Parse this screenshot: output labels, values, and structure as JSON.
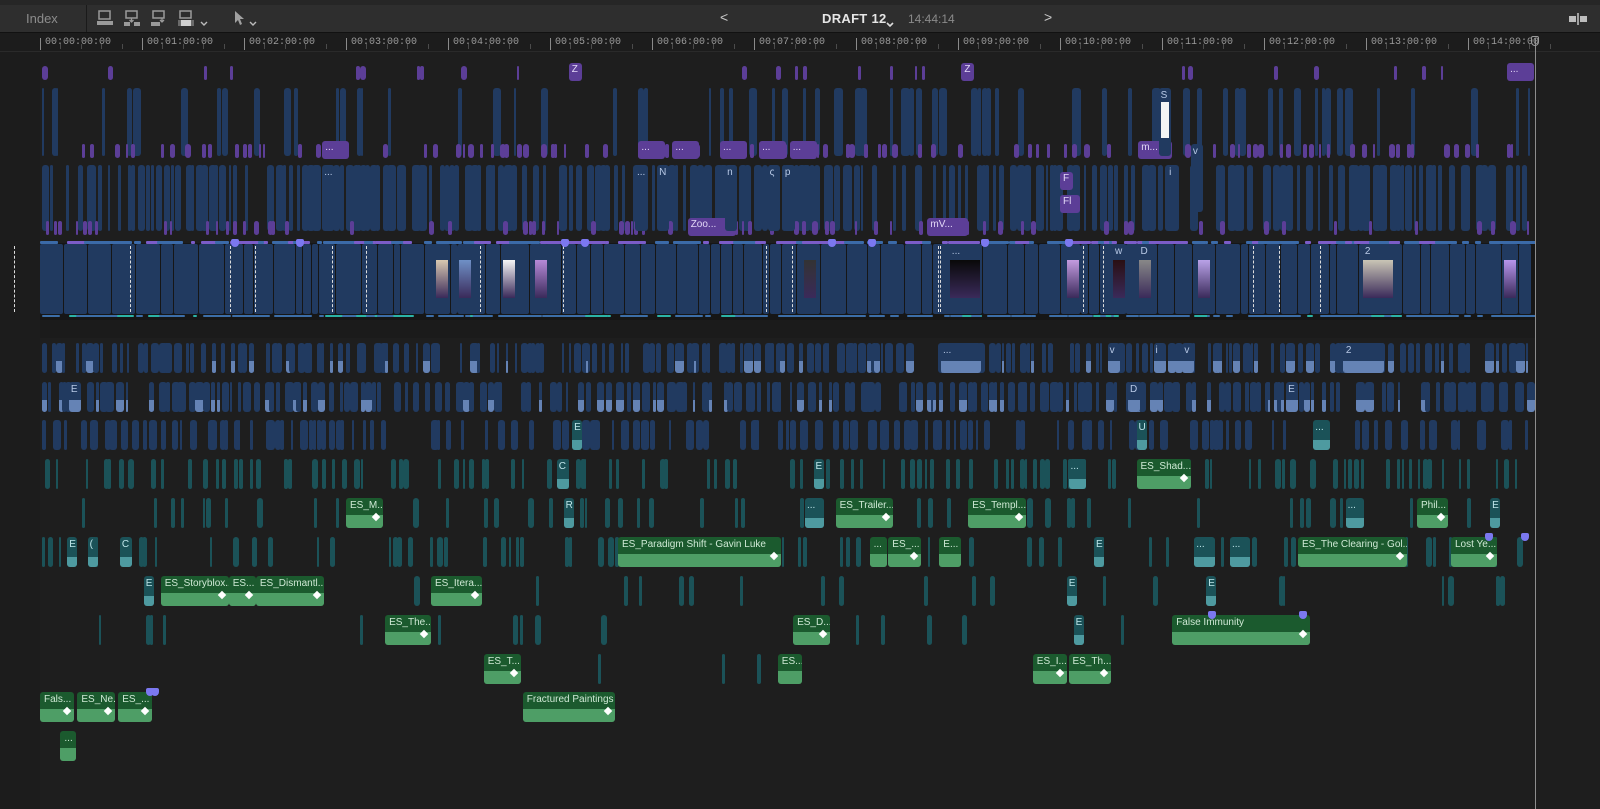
{
  "toolbar": {
    "index_label": "Index",
    "project_name": "DRAFT 12",
    "project_duration": "14:44:14",
    "prev_label": "<",
    "next_label": ">",
    "edit_buttons": [
      "connect-clip",
      "insert-clip",
      "append-clip",
      "overwrite-clip"
    ],
    "tool": "select-arrow"
  },
  "ruler": {
    "labels": [
      "00:00:00:00",
      "00:01:00:00",
      "00:02:00:00",
      "00:03:00:00",
      "00:04:00:00",
      "00:05:00:00",
      "00:06:00:00",
      "00:07:00:00",
      "00:08:00:00",
      "00:09:00:00",
      "00:10:00:00",
      "00:11:00:00",
      "00:12:00:00",
      "00:13:00:00",
      "00:14:00:00"
    ]
  },
  "playhead": {
    "timecode_seconds": 870
  },
  "colors": {
    "video": "#213a60",
    "title": "#5c3e97",
    "audio": "#1b5a2e",
    "audio_teal": "#1b5258",
    "marker": "#7b78f0"
  },
  "timeline": {
    "titles": [
      {
        "t": 311,
        "lane": "t1",
        "label": "Z"
      },
      {
        "t": 542,
        "lane": "t1",
        "label": "Z"
      },
      {
        "t": 863,
        "lane": "t1",
        "label": "..."
      },
      {
        "t": 166,
        "lane": "t3",
        "label": "..."
      },
      {
        "t": 352,
        "lane": "t3",
        "label": "..."
      },
      {
        "t": 372,
        "lane": "t3",
        "label": "..."
      },
      {
        "t": 400,
        "lane": "t3",
        "label": "..."
      },
      {
        "t": 423,
        "lane": "t3",
        "label": "..."
      },
      {
        "t": 441,
        "lane": "t3",
        "label": "..."
      },
      {
        "t": 646,
        "lane": "t3",
        "label": "m..."
      },
      {
        "t": 381,
        "lane": "t4b",
        "label": "Zoo..."
      },
      {
        "t": 522,
        "lane": "t4b",
        "label": "mV..."
      },
      {
        "t": 600,
        "lane": "t4a",
        "label": "F"
      },
      {
        "t": 600,
        "lane": "t4c",
        "label": "Fl"
      }
    ],
    "connected_video": [
      {
        "t": 166,
        "lane": "v1",
        "label": "..."
      },
      {
        "t": 350,
        "lane": "v1",
        "label": "..."
      },
      {
        "t": 363,
        "lane": "v1",
        "label": "N"
      },
      {
        "t": 403,
        "lane": "v1",
        "label": "n"
      },
      {
        "t": 428,
        "lane": "v1",
        "label": "ς"
      },
      {
        "t": 437,
        "lane": "v1",
        "label": "p"
      },
      {
        "t": 658,
        "lane": "v0",
        "label": "S"
      },
      {
        "t": 663,
        "lane": "v1",
        "label": "i"
      },
      {
        "t": 677,
        "lane": "v1b",
        "label": "v"
      },
      {
        "t": 530,
        "lane": "a1",
        "label": "..."
      },
      {
        "t": 767,
        "lane": "a1",
        "label": "2"
      },
      {
        "t": 628,
        "lane": "a1",
        "label": "v"
      },
      {
        "t": 655,
        "lane": "a1",
        "label": "i"
      },
      {
        "t": 672,
        "lane": "a1",
        "label": "v"
      },
      {
        "t": 17,
        "lane": "a2",
        "label": "E"
      },
      {
        "t": 640,
        "lane": "a2",
        "label": "D"
      },
      {
        "t": 733,
        "lane": "a2",
        "label": "E"
      }
    ],
    "primary_storyline": {
      "thumbnail_clips": [
        {
          "t": 232,
          "label": ""
        },
        {
          "t": 245,
          "label": ""
        },
        {
          "t": 271,
          "label": ""
        },
        {
          "t": 290,
          "label": ""
        },
        {
          "t": 448,
          "label": ""
        },
        {
          "t": 534,
          "label": "..."
        },
        {
          "t": 603,
          "label": ""
        },
        {
          "t": 630,
          "label": "w"
        },
        {
          "t": 645,
          "label": "D"
        },
        {
          "t": 680,
          "label": ""
        },
        {
          "t": 777,
          "label": "2"
        },
        {
          "t": 860,
          "label": ""
        }
      ]
    },
    "audio_named": [
      {
        "t": 180,
        "dur": 22,
        "lane": "a5",
        "label": "ES_M..."
      },
      {
        "t": 468,
        "dur": 34,
        "lane": "a5",
        "label": "ES_Trailer..."
      },
      {
        "t": 546,
        "dur": 34,
        "lane": "a5",
        "label": "ES_Templ..."
      },
      {
        "t": 645,
        "dur": 32,
        "lane": "a4",
        "label": "ES_Shad..."
      },
      {
        "t": 810,
        "dur": 18,
        "lane": "a5",
        "label": "Phil..."
      },
      {
        "t": 340,
        "dur": 96,
        "lane": "a6",
        "label": "ES_Paradigm Shift - Gavin Luke"
      },
      {
        "t": 488,
        "dur": 10,
        "lane": "a6",
        "label": "..."
      },
      {
        "t": 499,
        "dur": 19,
        "lane": "a6",
        "label": "ES_..."
      },
      {
        "t": 529,
        "dur": 13,
        "lane": "a6",
        "label": "E..."
      },
      {
        "t": 740,
        "dur": 64,
        "lane": "a6",
        "label": "ES_The Clearing - Gol..."
      },
      {
        "t": 830,
        "dur": 27,
        "lane": "a6",
        "label": "Lost Ye..."
      },
      {
        "t": 71,
        "dur": 40,
        "lane": "a7",
        "label": "ES_Storyblox..."
      },
      {
        "t": 111,
        "dur": 16,
        "lane": "a7",
        "label": "ES..."
      },
      {
        "t": 127,
        "dur": 40,
        "lane": "a7",
        "label": "ES_Dismantl..."
      },
      {
        "t": 230,
        "dur": 30,
        "lane": "a7",
        "label": "ES_Itera..."
      },
      {
        "t": 203,
        "dur": 27,
        "lane": "a8",
        "label": "ES_The..."
      },
      {
        "t": 443,
        "dur": 22,
        "lane": "a8",
        "label": "ES_D..."
      },
      {
        "t": 666,
        "dur": 81,
        "lane": "a8",
        "label": "False Immunity"
      },
      {
        "t": 261,
        "dur": 22,
        "lane": "a9",
        "label": "ES_T..."
      },
      {
        "t": 434,
        "dur": 14,
        "lane": "a9",
        "label": "ES..."
      },
      {
        "t": 584,
        "dur": 20,
        "lane": "a9",
        "label": "ES_I..."
      },
      {
        "t": 605,
        "dur": 25,
        "lane": "a9",
        "label": "ES_Th..."
      },
      {
        "t": 0,
        "dur": 20,
        "lane": "a10",
        "label": "Fals..."
      },
      {
        "t": 22,
        "dur": 22,
        "lane": "a10",
        "label": "ES_Ne..."
      },
      {
        "t": 46,
        "dur": 20,
        "lane": "a10",
        "label": "ES_..."
      },
      {
        "t": 284,
        "dur": 54,
        "lane": "a10",
        "label": "Fractured Paintings"
      },
      {
        "t": 12,
        "dur": 9,
        "lane": "a11",
        "label": "..."
      }
    ],
    "audio_teal_named": [
      {
        "t": 313,
        "dur": 6,
        "lane": "a3",
        "label": "E"
      },
      {
        "t": 304,
        "dur": 7,
        "lane": "a4",
        "label": "C"
      },
      {
        "t": 455,
        "dur": 6,
        "lane": "a4",
        "label": "E"
      },
      {
        "t": 308,
        "dur": 6,
        "lane": "a5",
        "label": "R"
      },
      {
        "t": 450,
        "dur": 11,
        "lane": "a5",
        "label": "..."
      },
      {
        "t": 768,
        "dur": 11,
        "lane": "a5",
        "label": "..."
      },
      {
        "t": 605,
        "dur": 10,
        "lane": "a4",
        "label": "..."
      },
      {
        "t": 645,
        "dur": 6,
        "lane": "a3",
        "label": "U"
      },
      {
        "t": 749,
        "dur": 10,
        "lane": "a3",
        "label": "..."
      },
      {
        "t": 16,
        "dur": 6,
        "lane": "a6",
        "label": "E"
      },
      {
        "t": 28,
        "dur": 4,
        "lane": "a6",
        "label": "("
      },
      {
        "t": 47,
        "dur": 7,
        "lane": "a6",
        "label": "C"
      },
      {
        "t": 679,
        "dur": 12,
        "lane": "a6",
        "label": "..."
      },
      {
        "t": 700,
        "dur": 12,
        "lane": "a6",
        "label": "..."
      },
      {
        "t": 620,
        "dur": 5,
        "lane": "a6",
        "label": "E"
      },
      {
        "t": 61,
        "dur": 5,
        "lane": "a7",
        "label": "E"
      },
      {
        "t": 604,
        "dur": 5,
        "lane": "a7",
        "label": "E"
      },
      {
        "t": 686,
        "dur": 5,
        "lane": "a7",
        "label": "E"
      },
      {
        "t": 608,
        "dur": 5,
        "lane": "a8",
        "label": "E"
      },
      {
        "t": 853,
        "dur": 5,
        "lane": "a5",
        "label": "E"
      }
    ]
  }
}
